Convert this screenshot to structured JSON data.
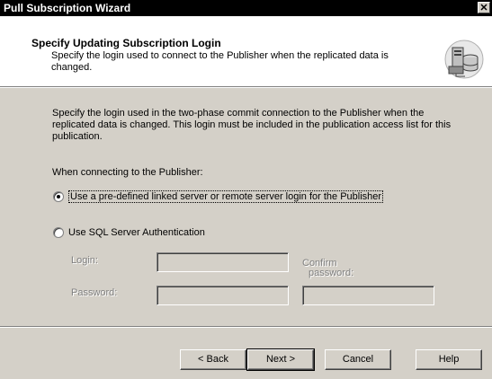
{
  "window": {
    "title": "Pull Subscription Wizard",
    "close_glyph": "✕"
  },
  "header": {
    "title": "Specify Updating Subscription Login",
    "subtitle": "Specify the login used to connect to the Publisher when the replicated data is changed.",
    "icon": "database-server-icon"
  },
  "body": {
    "description": "Specify the login used in the two-phase commit connection to the Publisher when the replicated data is changed. This login must be included in the publication access list for this publication.",
    "prompt": "When connecting to the Publisher:",
    "options": [
      {
        "label": "Use a pre-defined linked server or remote server login for the Publisher",
        "checked": true
      },
      {
        "label": "Use SQL Server Authentication",
        "checked": false
      }
    ],
    "login_label": "Login:",
    "password_label": "Password:",
    "confirm_label_1": "Confirm",
    "confirm_label_2": "password:",
    "login_value": "",
    "password_value": "",
    "confirm_value": ""
  },
  "buttons": {
    "back": "< Back",
    "next": "Next >",
    "cancel": "Cancel",
    "help": "Help"
  }
}
